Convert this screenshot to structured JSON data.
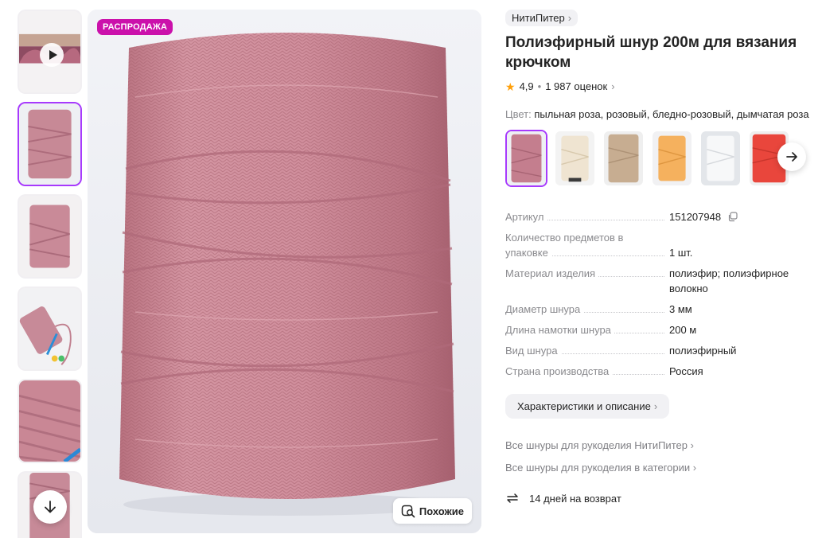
{
  "media": {
    "sale_badge": "РАСПРОДАЖА",
    "similar_label": "Похожие",
    "thumbnails": [
      "video",
      "spool-front",
      "spool-side",
      "spool-with-tools",
      "cord-closeup",
      "spool-top"
    ]
  },
  "product": {
    "brand": "НитиПитер",
    "title": "Полиэфирный шнур 200м для вязания крючком",
    "rating": "4,9",
    "reviews": "1 987 оценок",
    "color_label": "Цвет:",
    "color_value": "пыльная роза, розовый, бледно-розовый, дымчатая роза",
    "swatches": [
      "#c47e8e",
      "#efe4d1",
      "#c7ad91",
      "#f5b15e",
      "#eef0f2",
      "#e9463c"
    ]
  },
  "specs": [
    {
      "key": "Артикул",
      "value": "151207948"
    },
    {
      "key": "Количество предметов в упаковке",
      "value": "1 шт."
    },
    {
      "key": "Материал изделия",
      "value": "полиэфир; полиэфирное волокно"
    },
    {
      "key": "Диаметр шнура",
      "value": "3 мм"
    },
    {
      "key": "Длина намотки шнура",
      "value": "200 м"
    },
    {
      "key": "Вид шнура",
      "value": "полиэфирный"
    },
    {
      "key": "Страна производства",
      "value": "Россия"
    }
  ],
  "actions": {
    "description_button": "Характеристики и описание",
    "link_brand": "Все шнуры для рукоделия НитиПитер",
    "link_category": "Все шнуры для рукоделия в категории",
    "return_text": "14 дней на возврат"
  },
  "colors": {
    "accent": "#a73afd",
    "sale": "#cb11ab",
    "star": "#ff9f0a",
    "cord": "#c48594"
  }
}
